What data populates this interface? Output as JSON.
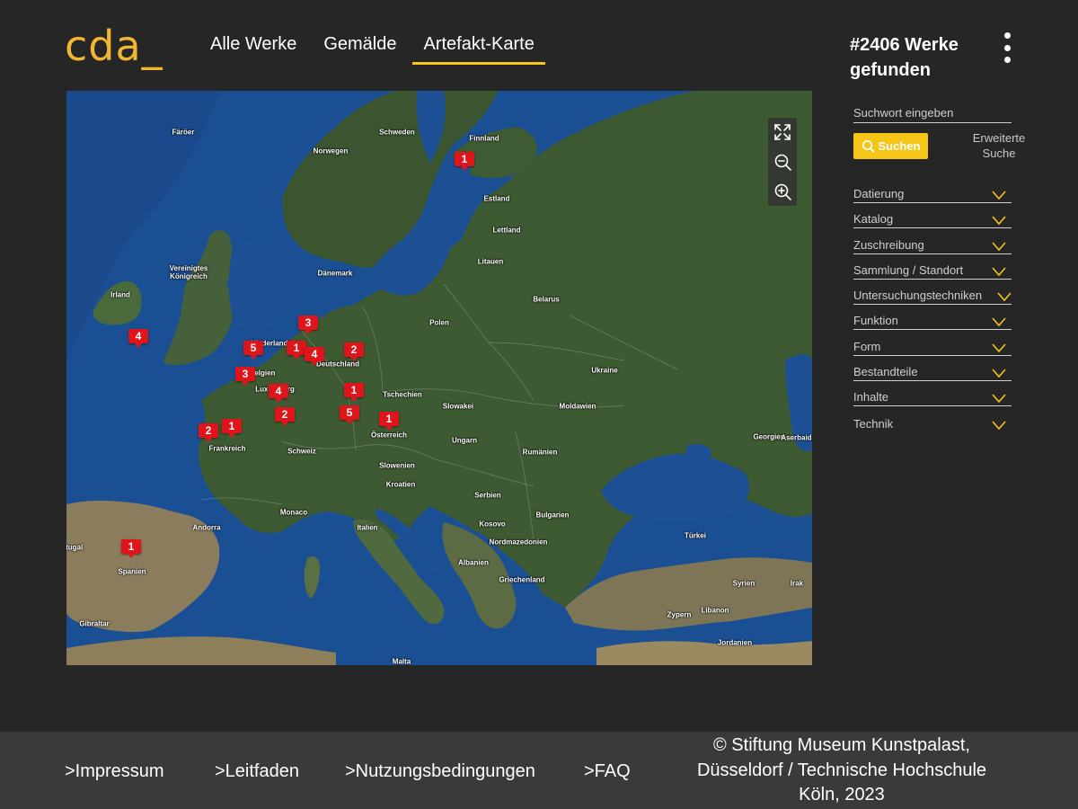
{
  "header": {
    "logo": "cda_",
    "nav": [
      "Alle Werke",
      "Gemälde",
      "Artefakt-Karte"
    ],
    "active_nav": "Artefakt-Karte",
    "result_count": "#2406 Werke gefunden"
  },
  "sidebar": {
    "search_placeholder": "Suchwort eingeben",
    "search_button": "Suchen",
    "advanced_search": "Erweiterte Suche",
    "filters": [
      "Datierung",
      "Katalog",
      "Zuschreibung",
      "Sammlung / Standort",
      "Untersuchungstechniken",
      "Funktion",
      "Form",
      "Bestandteile",
      "Inhalte",
      "Technik"
    ]
  },
  "map": {
    "places": [
      {
        "name": "Färöer"
      },
      {
        "name": "Schweden"
      },
      {
        "name": "Finnland"
      },
      {
        "name": "Norwegen"
      },
      {
        "name": "Estland"
      },
      {
        "name": "Lettland"
      },
      {
        "name": "Litauen"
      },
      {
        "name": "Dänemark"
      },
      {
        "name": "Vereinigtes Königreich"
      },
      {
        "name": "Irland"
      },
      {
        "name": "Belarus"
      },
      {
        "name": "Polen"
      },
      {
        "name": "Niederlande"
      },
      {
        "name": "Deutschland"
      },
      {
        "name": "Belgien"
      },
      {
        "name": "Luxemburg"
      },
      {
        "name": "Ukraine"
      },
      {
        "name": "Tschechien"
      },
      {
        "name": "Slowakei"
      },
      {
        "name": "Moldawien"
      },
      {
        "name": "Österreich"
      },
      {
        "name": "Frankreich"
      },
      {
        "name": "Schweiz"
      },
      {
        "name": "Ungarn"
      },
      {
        "name": "Rumänien"
      },
      {
        "name": "Georgien"
      },
      {
        "name": "Aserbaidschan"
      },
      {
        "name": "Slowenien"
      },
      {
        "name": "Kroatien"
      },
      {
        "name": "Serbien"
      },
      {
        "name": "Monaco"
      },
      {
        "name": "Andorra"
      },
      {
        "name": "Italien"
      },
      {
        "name": "Kosovo"
      },
      {
        "name": "Bulgarien"
      },
      {
        "name": "Nordmazedonien"
      },
      {
        "name": "Albanien"
      },
      {
        "name": "Türkei"
      },
      {
        "name": "Spanien"
      },
      {
        "name": "Portugal"
      },
      {
        "name": "Griechenland"
      },
      {
        "name": "Syrien"
      },
      {
        "name": "Irak"
      },
      {
        "name": "Zypern"
      },
      {
        "name": "Libanon"
      },
      {
        "name": "Jordanien"
      },
      {
        "name": "Gibraltar"
      },
      {
        "name": "Malta"
      }
    ],
    "markers": [
      {
        "count": "1",
        "region": "Finnland"
      },
      {
        "count": "4",
        "region": "Vereinigtes Königreich"
      },
      {
        "count": "3",
        "region": "Deutschland"
      },
      {
        "count": "5",
        "region": "Niederlande"
      },
      {
        "count": "1",
        "region": "Deutschland"
      },
      {
        "count": "4",
        "region": "Deutschland"
      },
      {
        "count": "2",
        "region": "Deutschland"
      },
      {
        "count": "3",
        "region": "Belgien"
      },
      {
        "count": "4",
        "region": "Luxemburg"
      },
      {
        "count": "1",
        "region": "Deutschland"
      },
      {
        "count": "2",
        "region": "Frankreich"
      },
      {
        "count": "5",
        "region": "Deutschland"
      },
      {
        "count": "1",
        "region": "Österreich"
      },
      {
        "count": "2",
        "region": "Frankreich"
      },
      {
        "count": "1",
        "region": "Frankreich"
      },
      {
        "count": "1",
        "region": "Spanien"
      }
    ],
    "controls": [
      "fullscreen-icon",
      "zoom-out-icon",
      "zoom-in-icon"
    ]
  },
  "footer": {
    "impressum": ">Impressum",
    "leitfaden": ">Leitfaden",
    "nutzung": ">Nutzungsbedingungen",
    "faq": ">FAQ",
    "copyright": "© Stiftung Museum Kunstpalast, Düsseldorf / Technische Hochschule Köln, 2023"
  },
  "colors": {
    "accent": "#f5c518",
    "logo": "#f2b632",
    "background": "#262626",
    "footer": "#3a3a3a",
    "marker": "#e0141b",
    "sea": "#1b4f93",
    "land": "#3e5a32"
  }
}
